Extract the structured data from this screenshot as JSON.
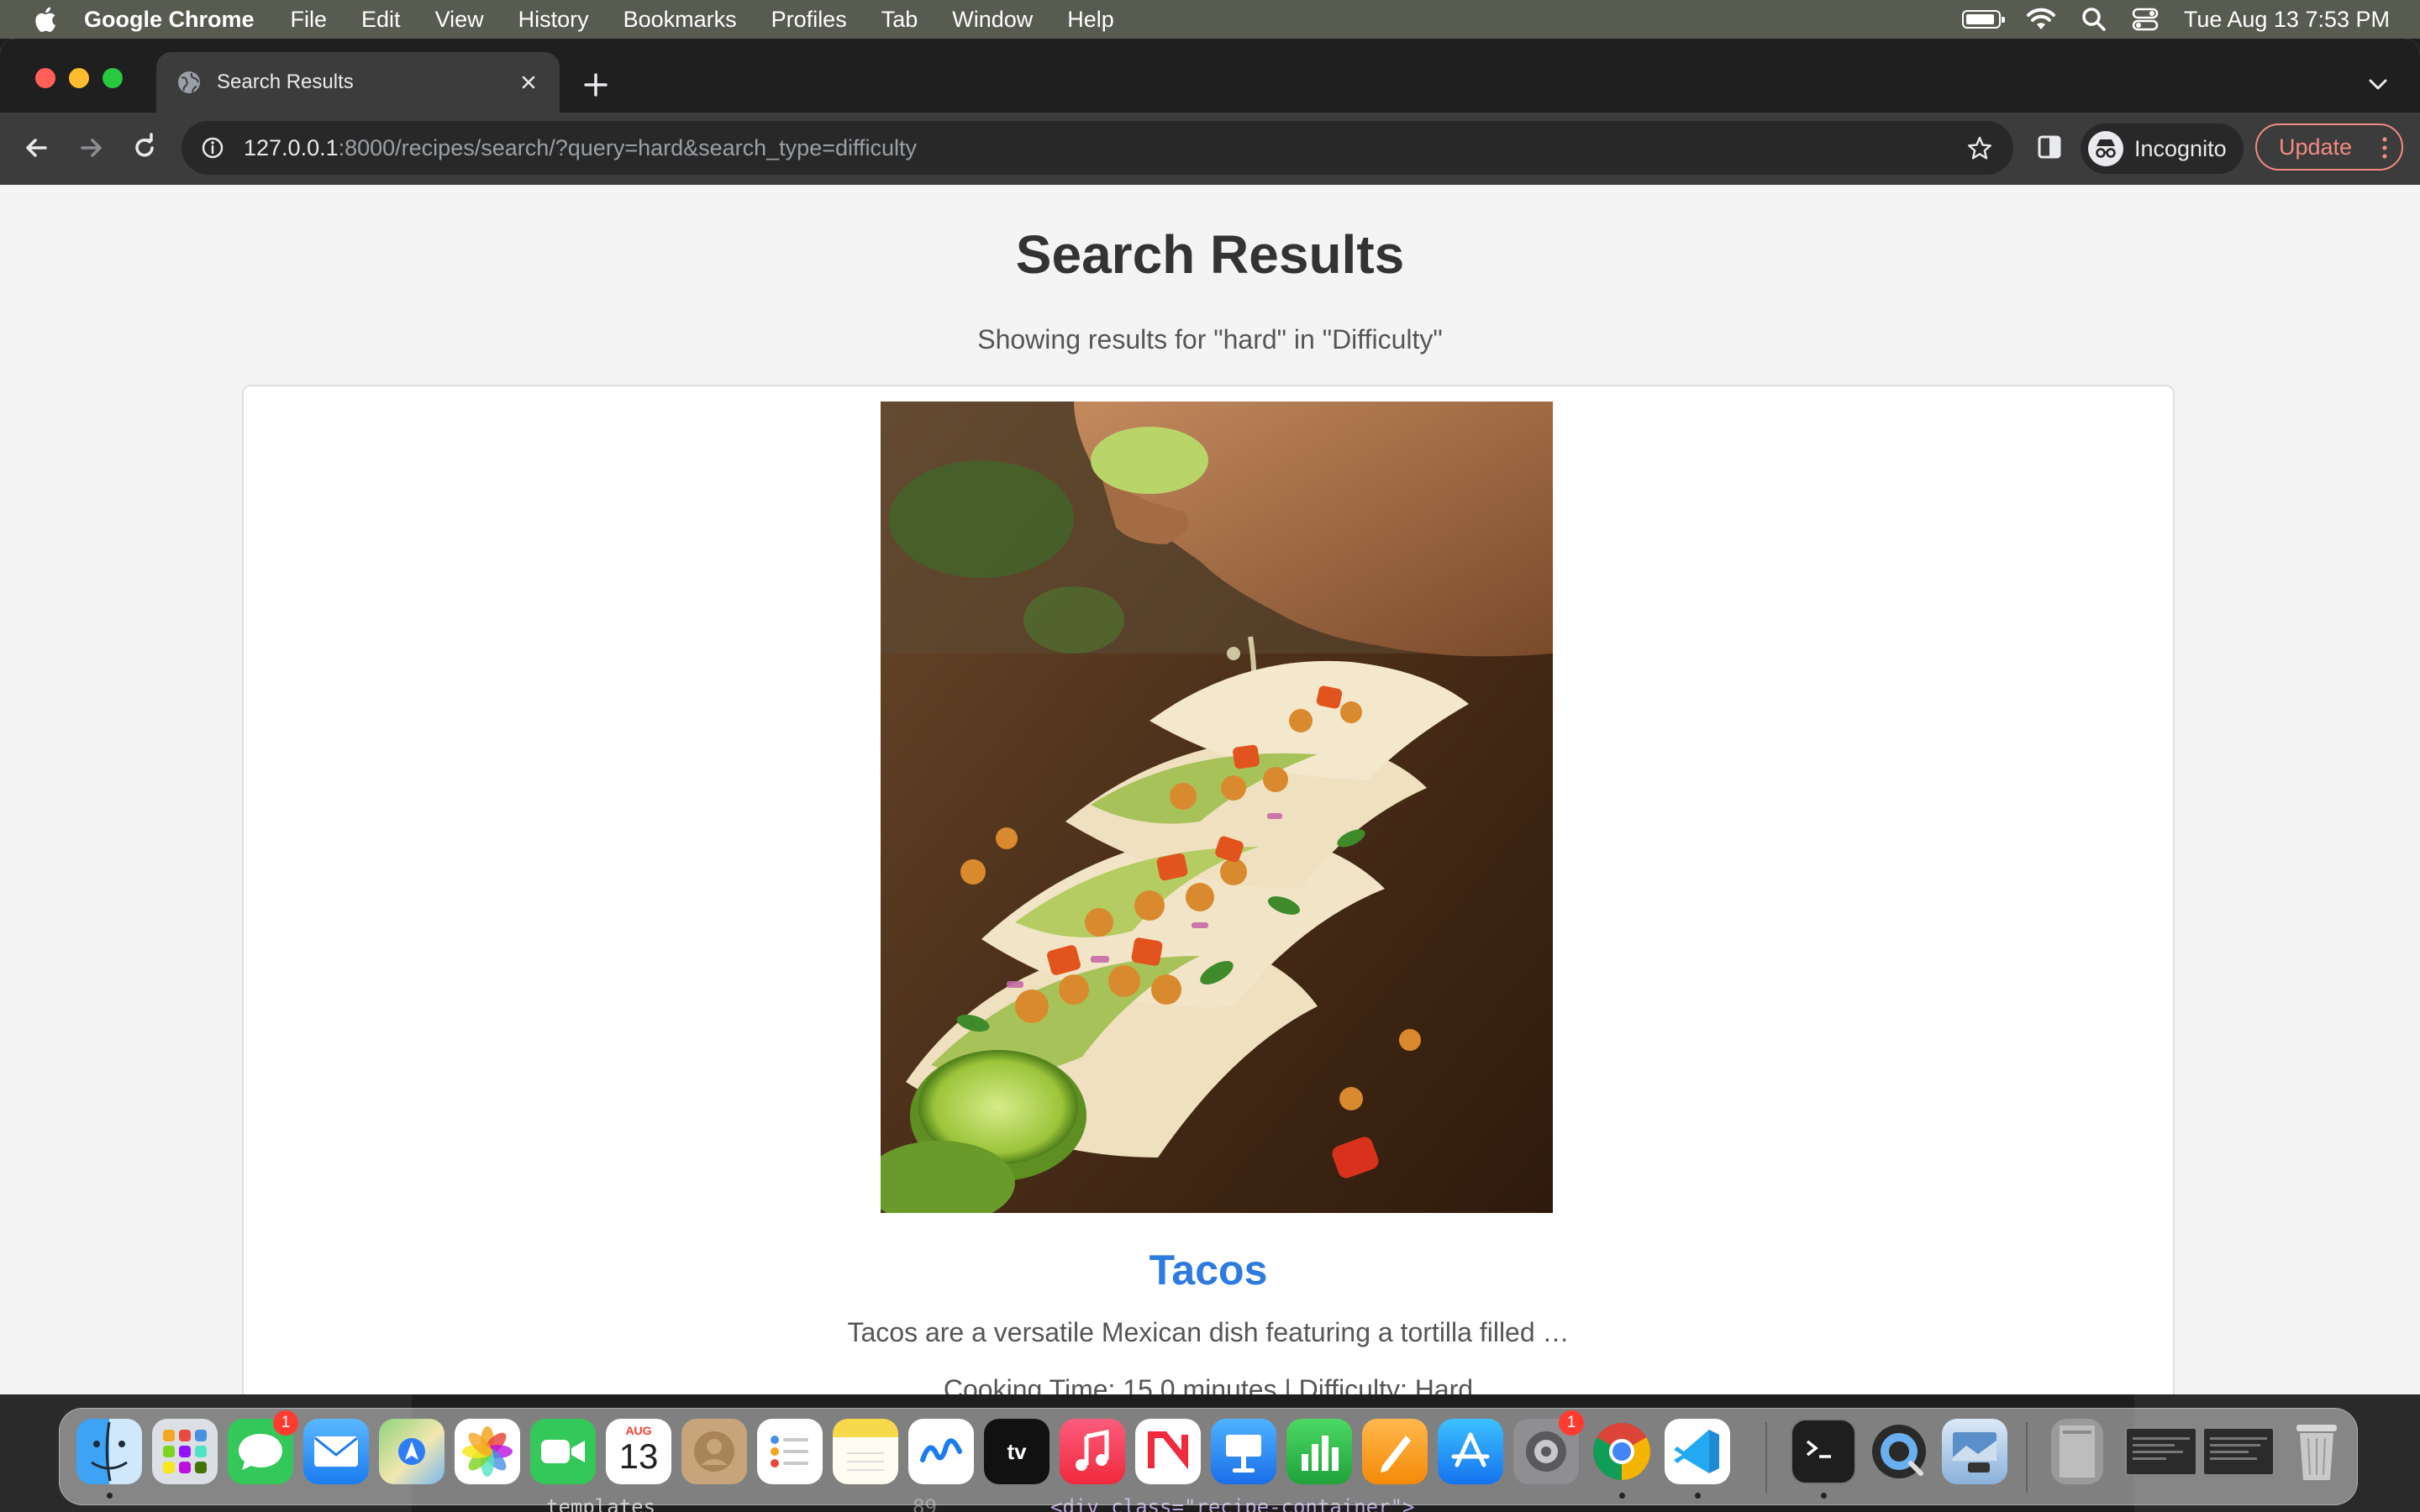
{
  "menubar": {
    "app_name": "Google Chrome",
    "items": [
      "File",
      "Edit",
      "View",
      "History",
      "Bookmarks",
      "Profiles",
      "Tab",
      "Window",
      "Help"
    ],
    "clock": "Tue Aug 13  7:53 PM"
  },
  "browser": {
    "tab_title": "Search Results",
    "url_host": "127.0.0.1",
    "url_rest": ":8000/recipes/search/?query=hard&search_type=difficulty",
    "profile_label": "Incognito",
    "update_label": "Update"
  },
  "page": {
    "title": "Search Results",
    "summary": "Showing results for \"hard\" in \"Difficulty\"",
    "results": [
      {
        "name": "Tacos",
        "description": "Tacos are a versatile Mexican dish featuring a tortilla filled …",
        "meta": "Cooking Time: 15.0 minutes | Difficulty: Hard"
      }
    ]
  },
  "dock": {
    "calendar_month": "AUG",
    "calendar_day": "13",
    "tv_label": "tv",
    "messages_badge": "1",
    "settings_badge": "1"
  },
  "editor_peek": {
    "line_text": "templates",
    "line_number": "89",
    "code": "<div class=\"recipe-container\">"
  },
  "colors": {
    "accent_link": "#2d7ae0",
    "update_button": "#f28b82"
  }
}
